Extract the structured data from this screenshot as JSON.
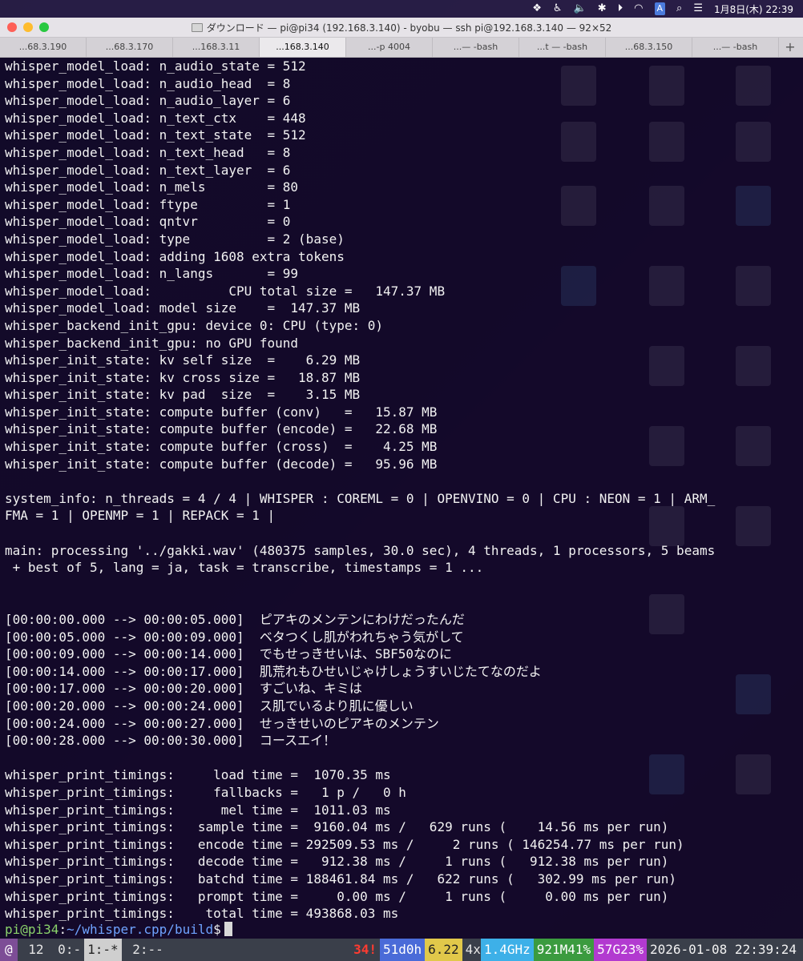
{
  "menubar": {
    "input_indicator": "A",
    "datetime": "1月8日(木) 22:39"
  },
  "window": {
    "title": "ダウンロード — pi@pi34 (192.168.3.140) - byobu — ssh pi@192.168.3.140 — 92×52"
  },
  "tabs": [
    {
      "label": "...68.3.190"
    },
    {
      "label": "...68.3.170"
    },
    {
      "label": "...168.3.11"
    },
    {
      "label": "...168.3.140"
    },
    {
      "label": "...-p 4004"
    },
    {
      "label": "...— -bash"
    },
    {
      "label": "...t — -bash"
    },
    {
      "label": "...68.3.150"
    },
    {
      "label": "...— -bash"
    }
  ],
  "tab_add_label": "+",
  "terminal_lines": [
    "whisper_model_load: n_audio_state = 512",
    "whisper_model_load: n_audio_head  = 8",
    "whisper_model_load: n_audio_layer = 6",
    "whisper_model_load: n_text_ctx    = 448",
    "whisper_model_load: n_text_state  = 512",
    "whisper_model_load: n_text_head   = 8",
    "whisper_model_load: n_text_layer  = 6",
    "whisper_model_load: n_mels        = 80",
    "whisper_model_load: ftype         = 1",
    "whisper_model_load: qntvr         = 0",
    "whisper_model_load: type          = 2 (base)",
    "whisper_model_load: adding 1608 extra tokens",
    "whisper_model_load: n_langs       = 99",
    "whisper_model_load:          CPU total size =   147.37 MB",
    "whisper_model_load: model size    =  147.37 MB",
    "whisper_backend_init_gpu: device 0: CPU (type: 0)",
    "whisper_backend_init_gpu: no GPU found",
    "whisper_init_state: kv self size  =    6.29 MB",
    "whisper_init_state: kv cross size =   18.87 MB",
    "whisper_init_state: kv pad  size  =    3.15 MB",
    "whisper_init_state: compute buffer (conv)   =   15.87 MB",
    "whisper_init_state: compute buffer (encode) =   22.68 MB",
    "whisper_init_state: compute buffer (cross)  =    4.25 MB",
    "whisper_init_state: compute buffer (decode) =   95.96 MB",
    "",
    "system_info: n_threads = 4 / 4 | WHISPER : COREML = 0 | OPENVINO = 0 | CPU : NEON = 1 | ARM_",
    "FMA = 1 | OPENMP = 1 | REPACK = 1 |",
    "",
    "main: processing '../gakki.wav' (480375 samples, 30.0 sec), 4 threads, 1 processors, 5 beams",
    " + best of 5, lang = ja, task = transcribe, timestamps = 1 ...",
    "",
    "",
    "[00:00:00.000 --> 00:00:05.000]  ピアキのメンテンにわけだったんだ",
    "[00:00:05.000 --> 00:00:09.000]  ベタつくし肌がわれちゃう気がして",
    "[00:00:09.000 --> 00:00:14.000]  でもせっきせいは、SBF50なのに",
    "[00:00:14.000 --> 00:00:17.000]  肌荒れもひせいじゃけしょうすいじたてなのだよ",
    "[00:00:17.000 --> 00:00:20.000]  すごいね、キミは",
    "[00:00:20.000 --> 00:00:24.000]  ス肌でいるより肌に優しい",
    "[00:00:24.000 --> 00:00:27.000]  せっきせいのピアキのメンテン",
    "[00:00:28.000 --> 00:00:30.000]  コースエイ！",
    "",
    "whisper_print_timings:     load time =  1070.35 ms",
    "whisper_print_timings:     fallbacks =   1 p /   0 h",
    "whisper_print_timings:      mel time =  1011.03 ms",
    "whisper_print_timings:   sample time =  9160.04 ms /   629 runs (    14.56 ms per run)",
    "whisper_print_timings:   encode time = 292509.53 ms /     2 runs ( 146254.77 ms per run)",
    "whisper_print_timings:   decode time =   912.38 ms /     1 runs (   912.38 ms per run)",
    "whisper_print_timings:   batchd time = 188461.84 ms /   622 runs (   302.99 ms per run)",
    "whisper_print_timings:   prompt time =     0.00 ms /     1 runs (     0.00 ms per run)",
    "whisper_print_timings:    total time = 493868.03 ms"
  ],
  "prompt": {
    "user_host": "pi@pi34",
    "sep": ":",
    "path": "~/whisper.cpp/build",
    "symbol": "$"
  },
  "statusbar": {
    "logo": "@",
    "count": " 12",
    "win0": " 0:-",
    "win1": "1:-*",
    "win2": " 2:--",
    "updates": "34!",
    "uptime": "51d0h",
    "load": "6.22",
    "cpu_count": "4x",
    "cpu_freq": "1.4GHz",
    "mem": "921M41%",
    "disk": "57G23%",
    "datetime": "2026-01-08 22:39:24"
  }
}
